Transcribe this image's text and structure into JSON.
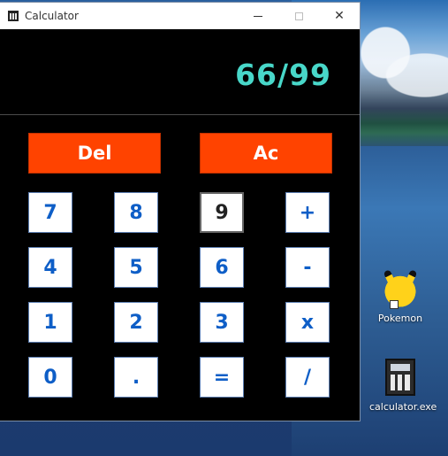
{
  "window": {
    "title": "Calculator",
    "controls": {
      "minimize": "minimize",
      "maximize": "maximize",
      "close": "✕"
    }
  },
  "display": {
    "value": "66/99"
  },
  "keys": {
    "del": "Del",
    "ac": "Ac",
    "rows": [
      [
        "7",
        "8",
        "9",
        "+"
      ],
      [
        "4",
        "5",
        "6",
        "-"
      ],
      [
        "1",
        "2",
        "3",
        "x"
      ],
      [
        "0",
        ".",
        "=",
        "/"
      ]
    ]
  },
  "desktop": {
    "icons": [
      {
        "label": "Pokemon",
        "icon": "pikachu-shortcut-icon"
      },
      {
        "label": "calculator.exe",
        "icon": "calculator-app-icon"
      }
    ]
  },
  "colors": {
    "display_text": "#48d7c9",
    "keypad_accent": "#0e5ec7",
    "del_ac_bg": "#ff4300",
    "window_bg": "#000000"
  }
}
